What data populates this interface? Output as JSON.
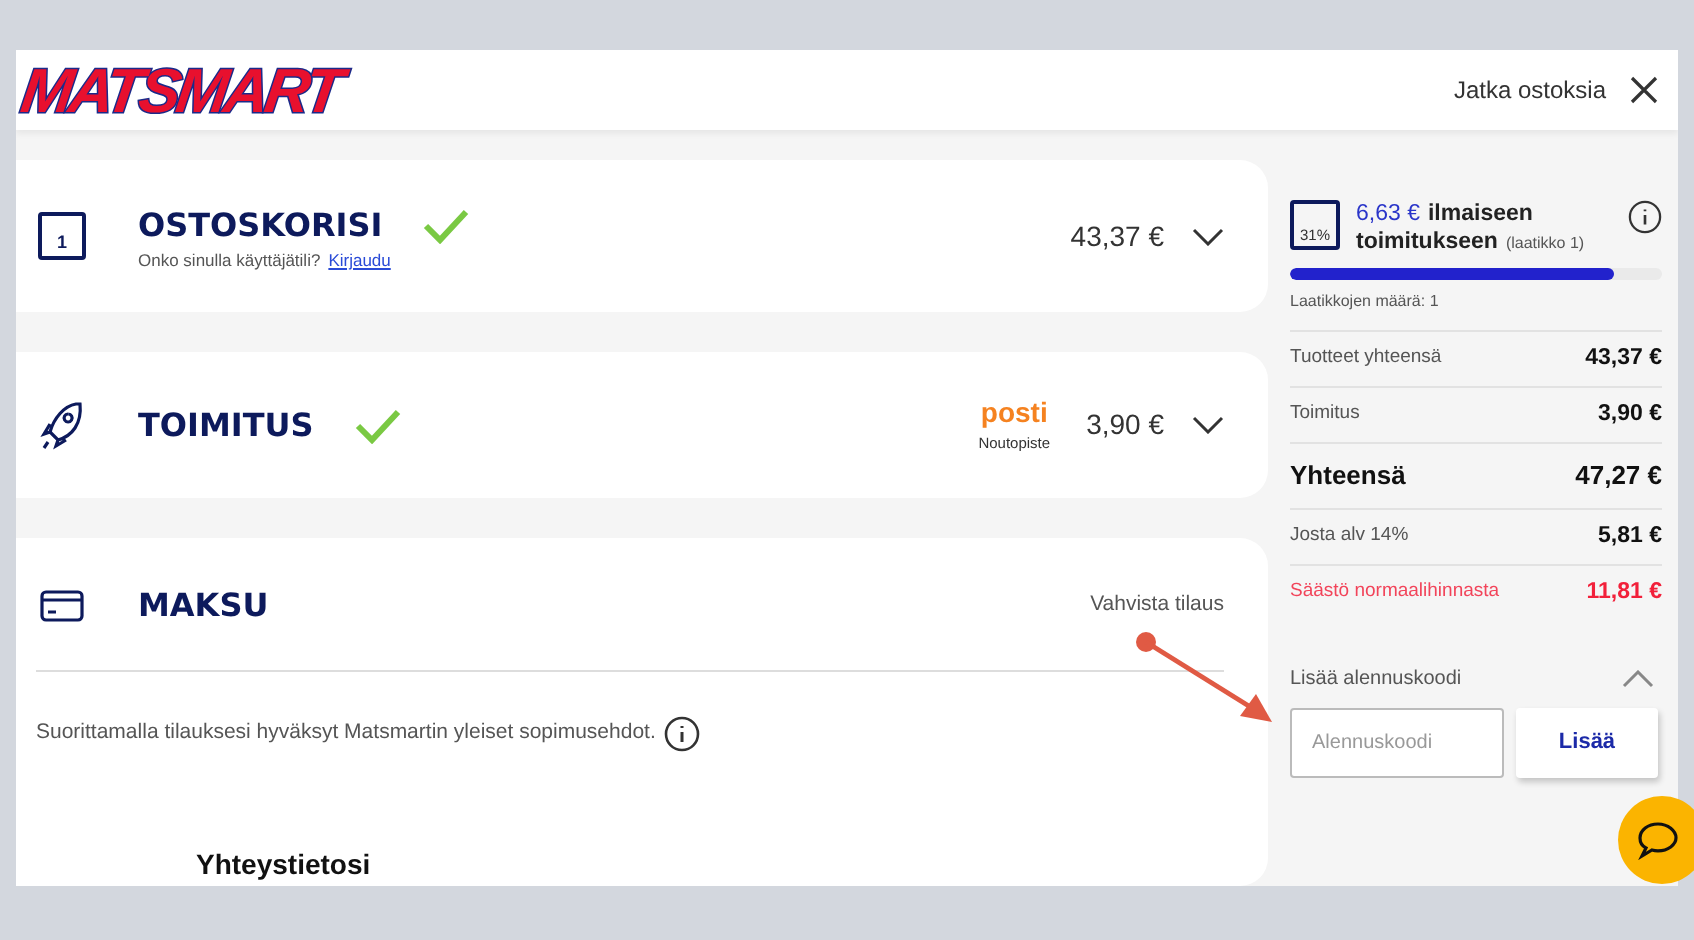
{
  "logo": "MATSMART",
  "header": {
    "continue_link": "Jatka ostoksia"
  },
  "sections": [
    {
      "kind": "cart",
      "title": "OSTOSKORISI",
      "icon_badge": "1",
      "subtitle": "Onko sinulla käyttäjätili?",
      "link": "Kirjaudu",
      "done": true,
      "amount": "43,37 €",
      "expanded": false
    },
    {
      "kind": "delivery",
      "title": "TOIMITUS",
      "done": true,
      "carrier": "posti",
      "carrier_note": "Noutopiste",
      "amount": "3,90 €",
      "expanded": false
    },
    {
      "kind": "payment",
      "title": "MAKSU",
      "done": false,
      "action": "Vahvista tilaus",
      "terms": "Suorittamalla tilauksesi hyväksyt Matsmartin yleiset sopimusehdot.",
      "subheading": "Yhteystietosi"
    }
  ],
  "free_shipping": {
    "box_percent": "31%",
    "amount": "6,63 €",
    "text1": "ilmaiseen",
    "text2": "toimitukseen",
    "note": "(laatikko 1)",
    "level": 0.87,
    "boxes": "Laatikkojen määrä: 1"
  },
  "summary": [
    {
      "kind": "normal",
      "label": "Tuotteet yhteensä",
      "value": "43,37 €"
    },
    {
      "kind": "normal",
      "label": "Toimitus",
      "value": "3,90 €"
    },
    {
      "kind": "total",
      "label": "Yhteensä",
      "value": "47,27 €"
    },
    {
      "kind": "normal",
      "label": "Josta alv 14%",
      "value": "5,81 €"
    },
    {
      "kind": "saving",
      "label": "Säästö normaalihinnasta",
      "value": "11,81 €"
    }
  ],
  "discount": {
    "label": "Lisää alennuskoodi",
    "expanded": true,
    "placeholder": "Alennuskoodi",
    "button": "Lisää"
  }
}
